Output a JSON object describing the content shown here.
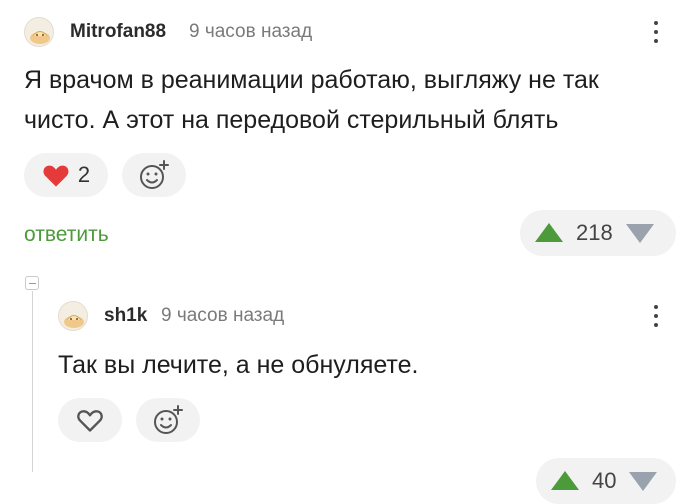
{
  "comments": [
    {
      "username": "Mitrofan88",
      "time": "9 часов назад",
      "text_lines": [
        "Я врачом в реанимации работаю, выгляжу не так",
        "чисто. А этот на передовой стерильный блять"
      ],
      "likes": "2",
      "reply_label": "ответить",
      "rating": "218",
      "icons": [
        "avatar",
        "more-vertical-icon",
        "heart-filled-icon",
        "add-reaction-icon",
        "arrow-up-icon",
        "arrow-down-icon"
      ]
    },
    {
      "username": "sh1k",
      "time": "9 часов назад",
      "text": "Так вы лечите, а не обнуляете.",
      "rating_partial": "40",
      "icons": [
        "avatar",
        "more-vertical-icon",
        "heart-outline-icon",
        "add-reaction-icon",
        "collapse-thread-icon"
      ]
    }
  ],
  "colors": {
    "heart": "#e53a3a",
    "upvote": "#4c9a3a",
    "downvote": "#9aa2ad",
    "reply_link": "#4c9a3a"
  }
}
